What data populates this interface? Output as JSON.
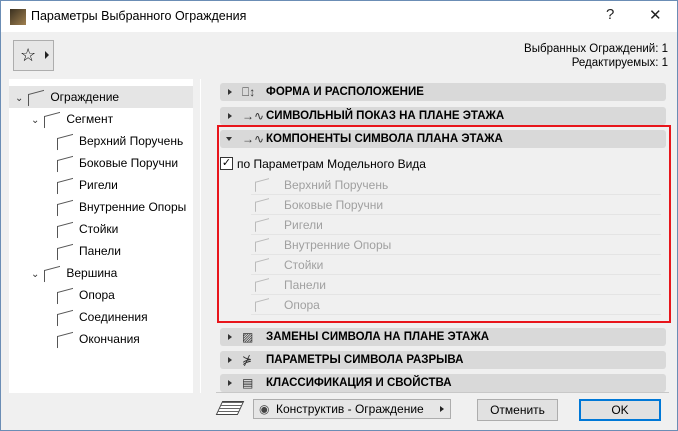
{
  "window": {
    "title": "Параметры Выбранного Ограждения",
    "help": "?",
    "close": "✕"
  },
  "info": {
    "selected": "Выбранных Ограждений: 1",
    "editable": "Редактируемых: 1"
  },
  "tree": [
    {
      "label": "Ограждение",
      "level": 0,
      "chev": "⌄"
    },
    {
      "label": "Сегмент",
      "level": 1,
      "chev": "⌄"
    },
    {
      "label": "Верхний Поручень",
      "level": 2
    },
    {
      "label": "Боковые Поручни",
      "level": 2
    },
    {
      "label": "Ригели",
      "level": 2
    },
    {
      "label": "Внутренние Опоры",
      "level": 2
    },
    {
      "label": "Стойки",
      "level": 2
    },
    {
      "label": "Панели",
      "level": 2
    },
    {
      "label": "Вершина",
      "level": 1,
      "chev": "⌄"
    },
    {
      "label": "Опора",
      "level": 2
    },
    {
      "label": "Соединения",
      "level": 2
    },
    {
      "label": "Окончания",
      "level": 2
    }
  ],
  "panels": [
    {
      "label": "ФОРМА И РАСПОЛОЖЕНИЕ",
      "icon": "⎕↕"
    },
    {
      "label": "СИМВОЛЬНЫЙ ПОКАЗ НА ПЛАНЕ ЭТАЖА",
      "icon": "→∿"
    },
    {
      "label": "КОМПОНЕНТЫ СИМВОЛА ПЛАНА ЭТАЖА",
      "icon": "→∿"
    },
    {
      "label": "ЗАМЕНЫ СИМВОЛА НА ПЛАНЕ ЭТАЖА",
      "icon": "▨"
    },
    {
      "label": "ПАРАМЕТРЫ СИМВОЛА РАЗРЫВА",
      "icon": "⋡"
    },
    {
      "label": "КЛАССИФИКАЦИЯ И СВОЙСТВА",
      "icon": "▤"
    }
  ],
  "components": {
    "checkbox_label": "по Параметрам Модельного Вида",
    "checked": true,
    "check": "✓",
    "items": [
      "Верхний Поручень",
      "Боковые Поручни",
      "Ригели",
      "Внутренние Опоры",
      "Стойки",
      "Панели",
      "Опора"
    ]
  },
  "footer": {
    "view": "Конструктив - Ограждение",
    "eye": "👁",
    "cancel": "Отменить",
    "ok": "OK"
  },
  "colors": {
    "highlight": "#e8151b",
    "ok_border": "#0078d7"
  }
}
